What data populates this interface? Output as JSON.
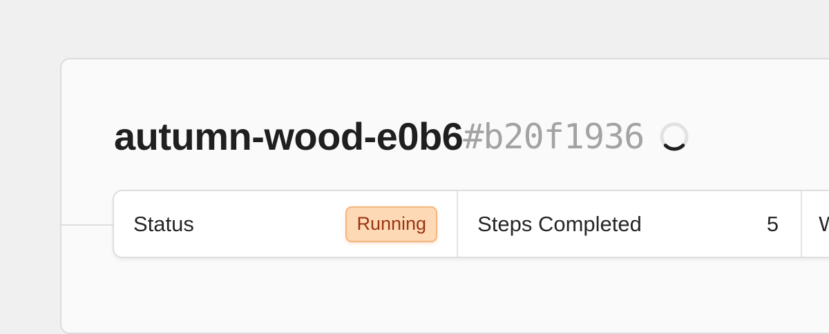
{
  "run": {
    "name": "autumn-wood-e0b6",
    "id": "#b20f1936",
    "loading": true
  },
  "stats": {
    "status_label": "Status",
    "status_value": "Running",
    "steps_label": "Steps Completed",
    "steps_value": "5",
    "next_label_partial": "W"
  },
  "colors": {
    "badge_bg": "#fdd9b5",
    "badge_border": "#f5b57f",
    "badge_text": "#9a3412",
    "id_text": "#a3a3a3"
  }
}
